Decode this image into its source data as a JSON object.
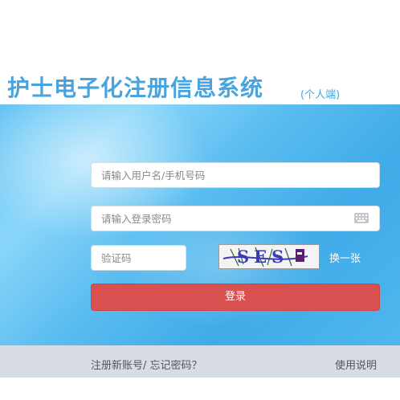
{
  "header": {
    "title": "护士电子化注册信息系统",
    "subtitle": "(个人端)"
  },
  "login": {
    "username_placeholder": "请输入用户名/手机号码",
    "password_placeholder": "请输入登录密码",
    "captcha_placeholder": "验证码",
    "captcha_image_text": "SES",
    "refresh_captcha_label": "换一张",
    "login_button_label": "登录"
  },
  "footer": {
    "register_link": "注册新账号/",
    "forgot_link": "忘记密码？",
    "help_link": "使用说明"
  },
  "colors": {
    "title": "#47a4df",
    "banner": "#5bbdf0",
    "login_button": "#d95050",
    "footer_bg": "#d7dce5"
  }
}
